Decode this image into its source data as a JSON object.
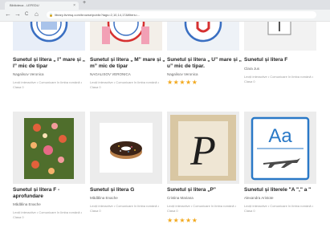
{
  "browser": {
    "tab_title": "Biblioteca - LEFEDU",
    "tab_close": "×",
    "new_tab": "+",
    "url": "library.livresq.com/browse/public?tags=2,10,14,17&filters=...",
    "back": "←",
    "forward": "→",
    "reload": "C",
    "home": "⌂"
  },
  "row1": [
    {
      "title": "Sunetul și litera „ l” mare și „ l” mic de tipar",
      "author": "Nagalisov Veronica",
      "meta": "Lecții interactive • Comunicare în limba română • Clasa 0",
      "stars": "",
      "colors": {
        "accent": "#3a6fc2"
      }
    },
    {
      "title": "Sunetul și litera „ M” mare și „ m” mic de tipar",
      "author": "NAGALISOV VERONICA",
      "meta": "Lecții interactive • Comunicare în limba română • Clasa 0",
      "stars": "",
      "colors": {
        "accent": "#d63131"
      }
    },
    {
      "title": "Sunetul și litera „ U” mare și „ u” mic de tipar.",
      "author": "Nagalisov Veronica",
      "meta": "",
      "stars": "★★★★★",
      "colors": {
        "accent": "#f2a91f"
      }
    },
    {
      "title": "Sunetul și litera F",
      "author": "Clara Jus",
      "meta": "Lecții interactive • Comunicare în limba română • Clasa 0",
      "stars": "",
      "colors": {
        "accent": "#888888"
      }
    }
  ],
  "row2": [
    {
      "title": "Sunetul și litera F - aprofundare",
      "author": "Mădălina Enache",
      "meta": "Lecții interactive • Comunicare în limba română • Clasa 0",
      "stars": ""
    },
    {
      "title": "Sunetul și litera G",
      "author": "Mădălina Enache",
      "meta": "Lecții interactive • Comunicare în limba română • Clasa 0",
      "stars": ""
    },
    {
      "title": "Sunetul și litera „P”",
      "author": "Cristina Mariana",
      "meta": "Lecții interactive • Comunicare în limba română • Clasa 0",
      "stars": "★★★★★"
    },
    {
      "title": "Sunetul și literele \"A \",\" a \"",
      "author": "Alexandra Aristote",
      "meta": "Lecții interactive • Comunicare în limba română • Clasa 0",
      "stars": ""
    }
  ],
  "thumbs": {
    "p_letter": "P",
    "aa_text": "Aa"
  }
}
